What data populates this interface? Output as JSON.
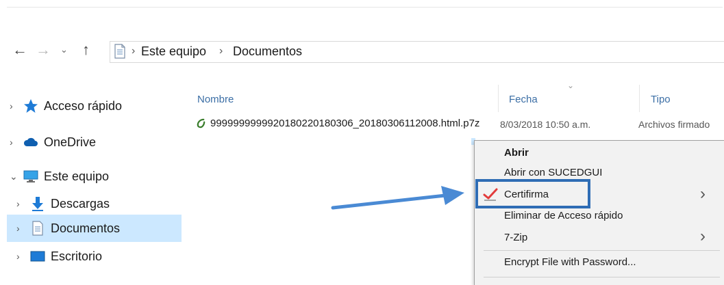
{
  "nav": {
    "back_icon": "arrow-left-icon",
    "forward_icon": "arrow-right-icon",
    "recent_icon": "chevron-down-icon",
    "up_icon": "arrow-up-icon"
  },
  "address": {
    "crumbs": [
      "Este equipo",
      "Documentos"
    ],
    "separator": "›"
  },
  "sidebar": {
    "items": [
      {
        "label": "Acceso rápido",
        "icon": "star-icon"
      },
      {
        "label": "OneDrive",
        "icon": "cloud-icon"
      },
      {
        "label": "Este equipo",
        "icon": "computer-icon"
      },
      {
        "label": "Descargas",
        "icon": "download-icon"
      },
      {
        "label": "Documentos",
        "icon": "document-icon"
      },
      {
        "label": "Escritorio",
        "icon": "desktop-icon"
      }
    ]
  },
  "columns": {
    "name": "Nombre",
    "date": "Fecha",
    "type": "Tipo"
  },
  "file": {
    "name": "9999999999920180220180306_20180306112008.html.p7z",
    "date": "8/03/2018 10:50 a.m.",
    "type": "Archivos firmado"
  },
  "context_menu": {
    "items": [
      {
        "label": "Abrir"
      },
      {
        "label": "Abrir con SUCEDGUI"
      },
      {
        "label": "Certifirma"
      },
      {
        "label": "Eliminar de Acceso rápido"
      },
      {
        "label": "7-Zip"
      },
      {
        "label": "Encrypt File with Password..."
      }
    ],
    "submenu_glyph": "›"
  },
  "colors": {
    "selection": "#cce8ff",
    "highlight_box": "#2f6db5",
    "arrow": "#4a8ad4",
    "header_text": "#3b6ea5"
  }
}
